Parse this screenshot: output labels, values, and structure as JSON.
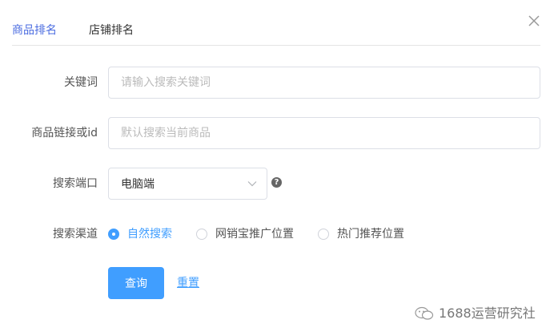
{
  "tabs": [
    {
      "label": "商品排名",
      "active": true
    },
    {
      "label": "店铺排名",
      "active": false
    }
  ],
  "form": {
    "keyword": {
      "label": "关键词",
      "placeholder": "请输入搜索关键词",
      "value": ""
    },
    "link": {
      "label": "商品链接或id",
      "placeholder": "默认搜索当前商品",
      "value": ""
    },
    "port": {
      "label": "搜索端口",
      "selected": "电脑端"
    },
    "channel": {
      "label": "搜索渠道",
      "options": [
        {
          "label": "自然搜索",
          "checked": true
        },
        {
          "label": "网销宝推广位置",
          "checked": false
        },
        {
          "label": "热门推荐位置",
          "checked": false
        }
      ]
    }
  },
  "buttons": {
    "query": "查询",
    "reset": "重置"
  },
  "help_glyph": "?",
  "watermark": {
    "text": "1688运营研究社"
  },
  "colors": {
    "accent": "#409eff",
    "tab_active": "#4a6be0",
    "border": "#dcdfe6"
  }
}
